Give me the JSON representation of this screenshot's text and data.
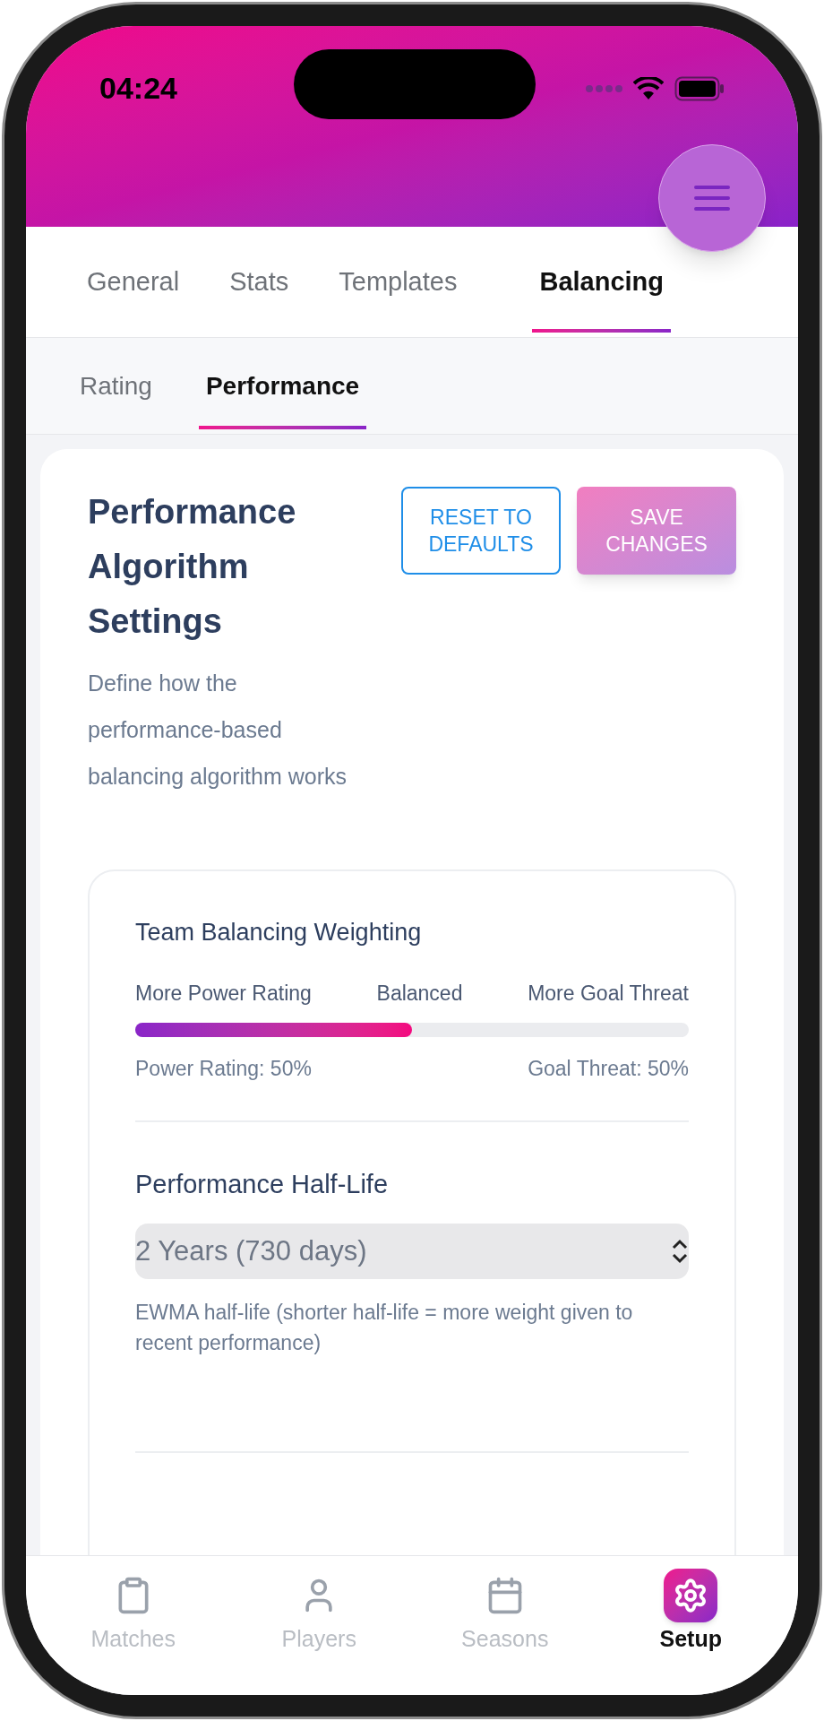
{
  "status_bar": {
    "time": "04:24"
  },
  "tabs": [
    {
      "label": "General",
      "selected": false
    },
    {
      "label": "Stats",
      "selected": false
    },
    {
      "label": "Templates",
      "selected": false
    },
    {
      "label": "Balancing",
      "selected": true
    }
  ],
  "subtabs": [
    {
      "label": "Rating",
      "selected": false
    },
    {
      "label": "Performance",
      "selected": true
    }
  ],
  "panel": {
    "title": "Performance Algorithm Settings",
    "description": "Define how the performance-based balancing algorithm works",
    "buttons": [
      {
        "kind": "outline",
        "label": "RESET TO DEFAULTS"
      },
      {
        "kind": "primary",
        "label": "SAVE CHANGES"
      }
    ]
  },
  "weighting": {
    "title": "Team Balancing Weighting",
    "scale_labels": [
      "More Power Rating",
      "Balanced",
      "More Goal Threat"
    ],
    "level": 0.5,
    "readings": [
      "Power Rating: 50%",
      "Goal Threat: 50%"
    ]
  },
  "half_life": {
    "title": "Performance Half-Life",
    "value": "2 Years (730 days)",
    "help": "EWMA half-life (shorter half-life = more weight given to recent performance)"
  },
  "bottom_nav": [
    {
      "kind": "matches",
      "label": "Matches",
      "selected": false
    },
    {
      "kind": "players",
      "label": "Players",
      "selected": false
    },
    {
      "kind": "seasons",
      "label": "Seasons",
      "selected": false
    },
    {
      "kind": "setup",
      "label": "Setup",
      "selected": true
    }
  ]
}
